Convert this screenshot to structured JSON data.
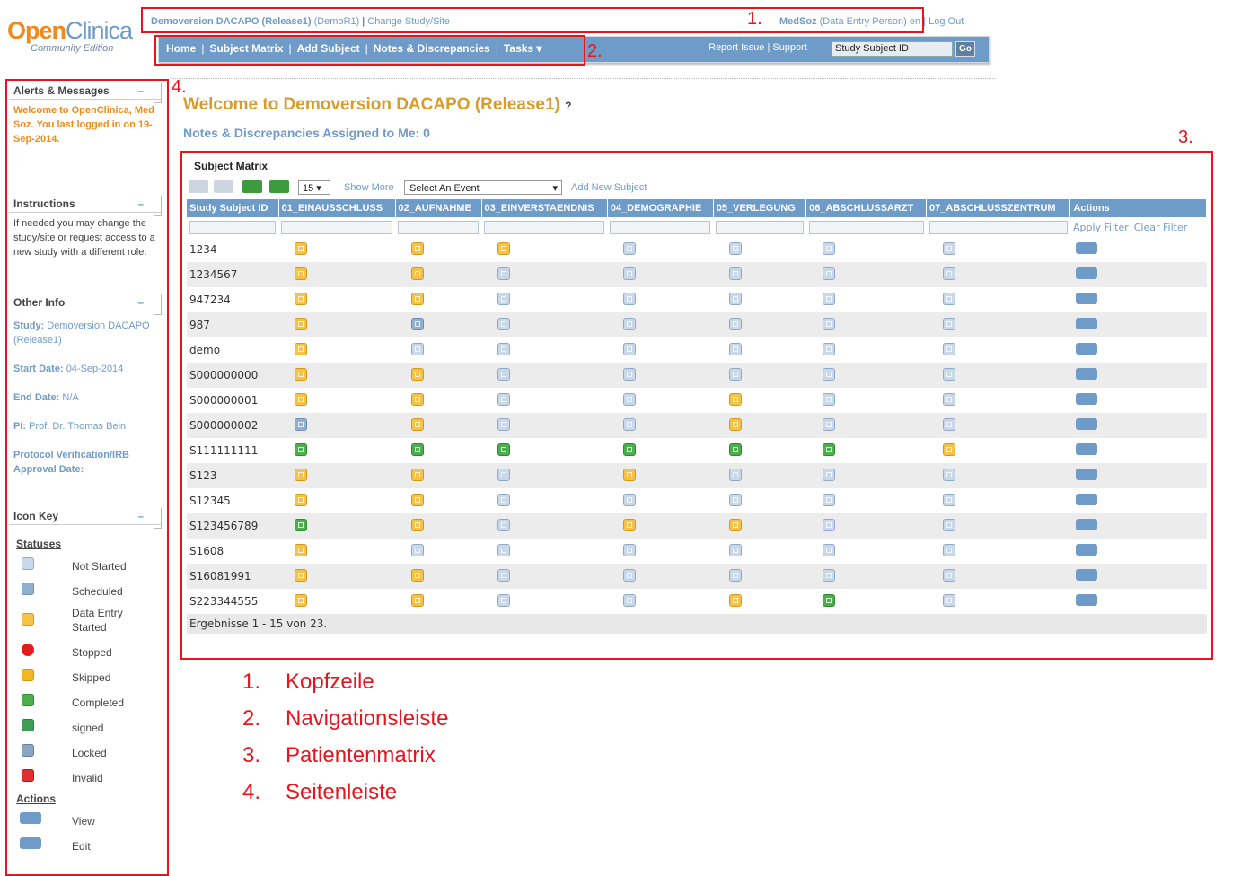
{
  "logo": {
    "part1": "Open",
    "part2": "Clinica",
    "sub": "Community Edition"
  },
  "top": {
    "study_name": "Demoversion DACAPO (Release1)",
    "study_code": "(DemoR1)",
    "sep": "|",
    "change_link": "Change Study/Site",
    "user_name": "MedSoz",
    "user_role": "(Data Entry Person)",
    "lang": "en",
    "logout": "Log Out"
  },
  "nav": {
    "items": [
      "Home",
      "Subject Matrix",
      "Add Subject",
      "Notes & Discrepancies",
      "Tasks ▾"
    ],
    "report": "Report Issue",
    "support": "Support",
    "search_value": "Study Subject ID",
    "go": "Go"
  },
  "annotations": {
    "a1": "1.",
    "a2": "2.",
    "a3": "3.",
    "a4": "4."
  },
  "sidebar": {
    "alerts_title": "Alerts & Messages",
    "alerts_text": "Welcome to OpenClinica, Med Soz. You last logged in on 19-Sep-2014.",
    "instr_title": "Instructions",
    "instr_text": "If needed you may change the study/site or request access to a new study with a different role.",
    "other_title": "Other Info",
    "study_label": "Study:",
    "study_value": "Demoversion DACAPO (Release1)",
    "start_label": "Start Date:",
    "start_value": "04-Sep-2014",
    "end_label": "End Date:",
    "end_value": "N/A",
    "pi_label": "PI:",
    "pi_value": "Prof. Dr. Thomas Bein",
    "protocol_label": "Protocol Verification/IRB Approval Date:",
    "iconkey_title": "Icon Key",
    "statuses_head": "Statuses",
    "statuses": [
      "Not Started",
      "Scheduled",
      "Data Entry Started",
      "Stopped",
      "Skipped",
      "Completed",
      "signed",
      "Locked",
      "Invalid"
    ],
    "actions_head": "Actions",
    "actions": [
      "View",
      "Edit"
    ],
    "minimize": "–"
  },
  "main": {
    "welcome": "Welcome to Demoversion DACAPO (Release1)",
    "help": "?",
    "notes": "Notes & Discrepancies Assigned to Me: 0",
    "matrix_title": "Subject Matrix",
    "page_size": "15",
    "show_more": "Show More",
    "event_select": "Select An Event",
    "add_subject": "Add New Subject",
    "apply_filter": "Apply Filter",
    "clear_filter": "Clear Filter",
    "footer": "Ergebnisse 1 - 15 von 23."
  },
  "matrix": {
    "columns": [
      "Study Subject ID",
      "01_EINAUSSCHLUSS",
      "02_AUFNAHME",
      "03_EINVERSTAENDNIS",
      "04_DEMOGRAPHIE",
      "05_VERLEGUNG",
      "06_ABSCHLUSSARZT",
      "07_ABSCHLUSSZENTRUM",
      "Actions"
    ],
    "rows": [
      {
        "id": "1234",
        "s": [
          "de",
          "de",
          "de",
          "ns",
          "ns",
          "ns",
          "ns"
        ]
      },
      {
        "id": "1234567",
        "s": [
          "de",
          "de",
          "ns",
          "ns",
          "ns",
          "ns",
          "ns"
        ]
      },
      {
        "id": "947234",
        "s": [
          "de",
          "de",
          "ns",
          "ns",
          "ns",
          "ns",
          "ns"
        ]
      },
      {
        "id": "987",
        "s": [
          "de",
          "sc",
          "ns",
          "ns",
          "ns",
          "ns",
          "ns"
        ]
      },
      {
        "id": "demo",
        "s": [
          "de",
          "ns",
          "ns",
          "ns",
          "ns",
          "ns",
          "ns"
        ]
      },
      {
        "id": "S000000000",
        "s": [
          "de",
          "de",
          "ns",
          "ns",
          "ns",
          "ns",
          "ns"
        ]
      },
      {
        "id": "S000000001",
        "s": [
          "de",
          "de",
          "ns",
          "ns",
          "de",
          "ns",
          "ns"
        ]
      },
      {
        "id": "S000000002",
        "s": [
          "sc",
          "de",
          "ns",
          "ns",
          "de",
          "ns",
          "ns"
        ]
      },
      {
        "id": "S111111111",
        "s": [
          "co",
          "co",
          "co",
          "co",
          "co",
          "co",
          "de"
        ]
      },
      {
        "id": "S123",
        "s": [
          "de",
          "de",
          "ns",
          "de",
          "ns",
          "ns",
          "ns"
        ]
      },
      {
        "id": "S12345",
        "s": [
          "de",
          "de",
          "ns",
          "ns",
          "ns",
          "ns",
          "ns"
        ]
      },
      {
        "id": "S123456789",
        "s": [
          "co",
          "de",
          "ns",
          "de",
          "de",
          "ns",
          "ns"
        ]
      },
      {
        "id": "S1608",
        "s": [
          "de",
          "ns",
          "ns",
          "ns",
          "ns",
          "ns",
          "ns"
        ]
      },
      {
        "id": "S16081991",
        "s": [
          "de",
          "de",
          "ns",
          "ns",
          "ns",
          "ns",
          "ns"
        ]
      },
      {
        "id": "S223344555",
        "s": [
          "de",
          "de",
          "ns",
          "ns",
          "de",
          "co",
          "ns"
        ]
      }
    ]
  },
  "legend": [
    {
      "n": "1.",
      "t": "Kopfzeile"
    },
    {
      "n": "2.",
      "t": "Navigationsleiste"
    },
    {
      "n": "3.",
      "t": "Patientenmatrix"
    },
    {
      "n": "4.",
      "t": "Seitenleiste"
    }
  ],
  "colors": {
    "accent": "#6f9bc8",
    "orange": "#f08a1c",
    "annotation_red": "#e8141c"
  }
}
